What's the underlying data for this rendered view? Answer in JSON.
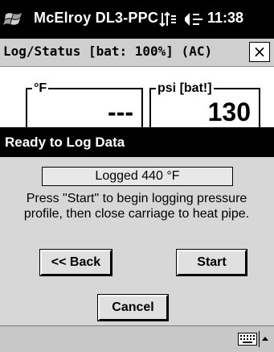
{
  "statusbar": {
    "app_title": "McElroy DL3-PPC",
    "time": "11:38",
    "icons": [
      "windows-flag-icon",
      "connectivity-icon",
      "speaker-icon"
    ]
  },
  "window": {
    "title": "Log/Status  [bat: 100%] (AC)",
    "close_label": "×"
  },
  "readouts": {
    "temperature": {
      "label": "°F",
      "value": "---"
    },
    "pressure": {
      "label": "psi [bat!]",
      "value": "130"
    }
  },
  "dialog": {
    "title": "Ready to Log Data",
    "logged_text": "Logged 440 °F",
    "instructions": "Press \"Start\" to begin logging pressure profile, then close carriage to heat pipe.",
    "back_label": "<< Back",
    "start_label": "Start",
    "cancel_label": "Cancel"
  },
  "bottombar": {
    "icons": [
      "keyboard-icon",
      "input-menu-arrow-icon"
    ]
  }
}
